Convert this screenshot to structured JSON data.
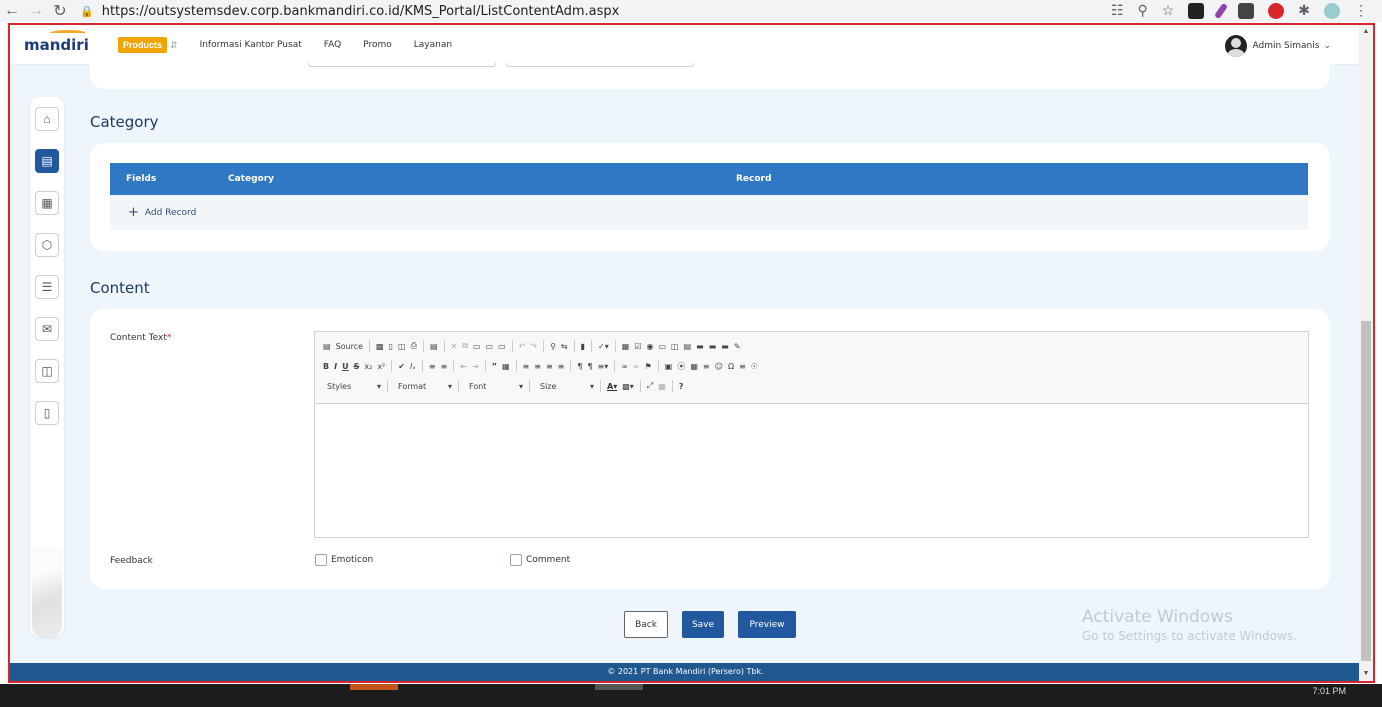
{
  "browser": {
    "url": "https://outsystemsdev.corp.bankmandiri.co.id/KMS_Portal/ListContentAdm.aspx"
  },
  "header": {
    "logo": "mandiri",
    "products_badge": "Products",
    "nav": [
      "Informasi Kantor Pusat",
      "FAQ",
      "Promo",
      "Layanan"
    ],
    "user_name": "Admin Simanis"
  },
  "sidebar": {
    "items": [
      {
        "icon": "home-icon"
      },
      {
        "icon": "document-icon",
        "active": true
      },
      {
        "icon": "grid-icon"
      },
      {
        "icon": "box-icon"
      },
      {
        "icon": "list-icon"
      },
      {
        "icon": "mail-icon"
      },
      {
        "icon": "layout-icon"
      },
      {
        "icon": "clipboard-icon"
      }
    ]
  },
  "category": {
    "title": "Category",
    "columns": [
      "Fields",
      "Category",
      "Record"
    ],
    "add_record": "Add Record"
  },
  "content": {
    "title": "Content",
    "content_text_label": "Content Text",
    "required_mark": "*",
    "toolbar": {
      "source": "Source",
      "styles": "Styles",
      "format": "Format",
      "font": "Font",
      "size": "Size"
    },
    "feedback_label": "Feedback",
    "emoticon_label": "Emoticon",
    "comment_label": "Comment"
  },
  "actions": {
    "back": "Back",
    "save": "Save",
    "preview": "Preview"
  },
  "watermark": {
    "line1": "Activate Windows",
    "line2": "Go to Settings to activate Windows."
  },
  "footer": {
    "text": "© 2021 PT Bank Mandiri (Persero) Tbk."
  },
  "taskbar": {
    "time": "7:01 PM"
  },
  "colors": {
    "primary": "#21589e",
    "table_header": "#2f78c4",
    "footer": "#20598f",
    "badge": "#f0a500",
    "page_bg": "#eef6fb"
  }
}
